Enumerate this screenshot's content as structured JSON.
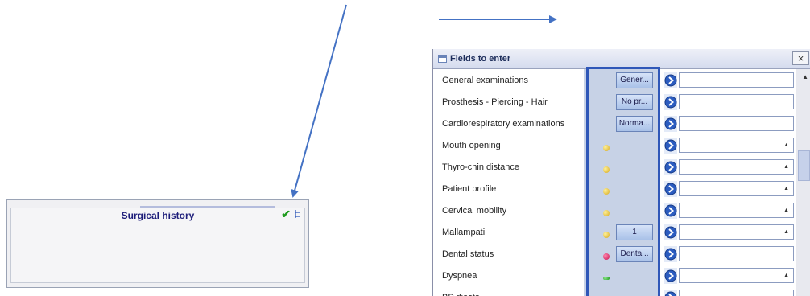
{
  "colors": {
    "arrow": "#4472c4",
    "frame": "#2f57b8",
    "status_column": "#c7d2e6",
    "title_text": "#1d1d7a"
  },
  "left_panel": {
    "title": "Surgical history",
    "check_icon": "check-icon",
    "tree_icon": "tree-icon"
  },
  "window": {
    "title": "Fields to enter",
    "close_label": "×",
    "rows": [
      {
        "label": "General examinations",
        "status": "none",
        "value": "Gener...",
        "field": "text"
      },
      {
        "label": "Prosthesis - Piercing - Hair",
        "status": "none",
        "value": "No pr...",
        "field": "text"
      },
      {
        "label": "Cardiorespiratory examinations",
        "status": "none",
        "value": "Norma...",
        "field": "text"
      },
      {
        "label": "Mouth opening",
        "status": "yellow",
        "value": "",
        "field": "dropdown"
      },
      {
        "label": "Thyro-chin distance",
        "status": "yellow",
        "value": "",
        "field": "dropdown"
      },
      {
        "label": "Patient profile",
        "status": "yellow",
        "value": "",
        "field": "dropdown"
      },
      {
        "label": "Cervical mobility",
        "status": "yellow",
        "value": "",
        "field": "dropdown"
      },
      {
        "label": "Mallampati",
        "status": "yellow",
        "value": "1",
        "field": "dropdown"
      },
      {
        "label": "Dental status",
        "status": "red",
        "value": "Denta...",
        "field": "text"
      },
      {
        "label": "Dyspnea",
        "status": "green",
        "value": "",
        "field": "dropdown"
      },
      {
        "label": "BP diasto",
        "status": "green",
        "value": "",
        "field": "text"
      }
    ]
  }
}
